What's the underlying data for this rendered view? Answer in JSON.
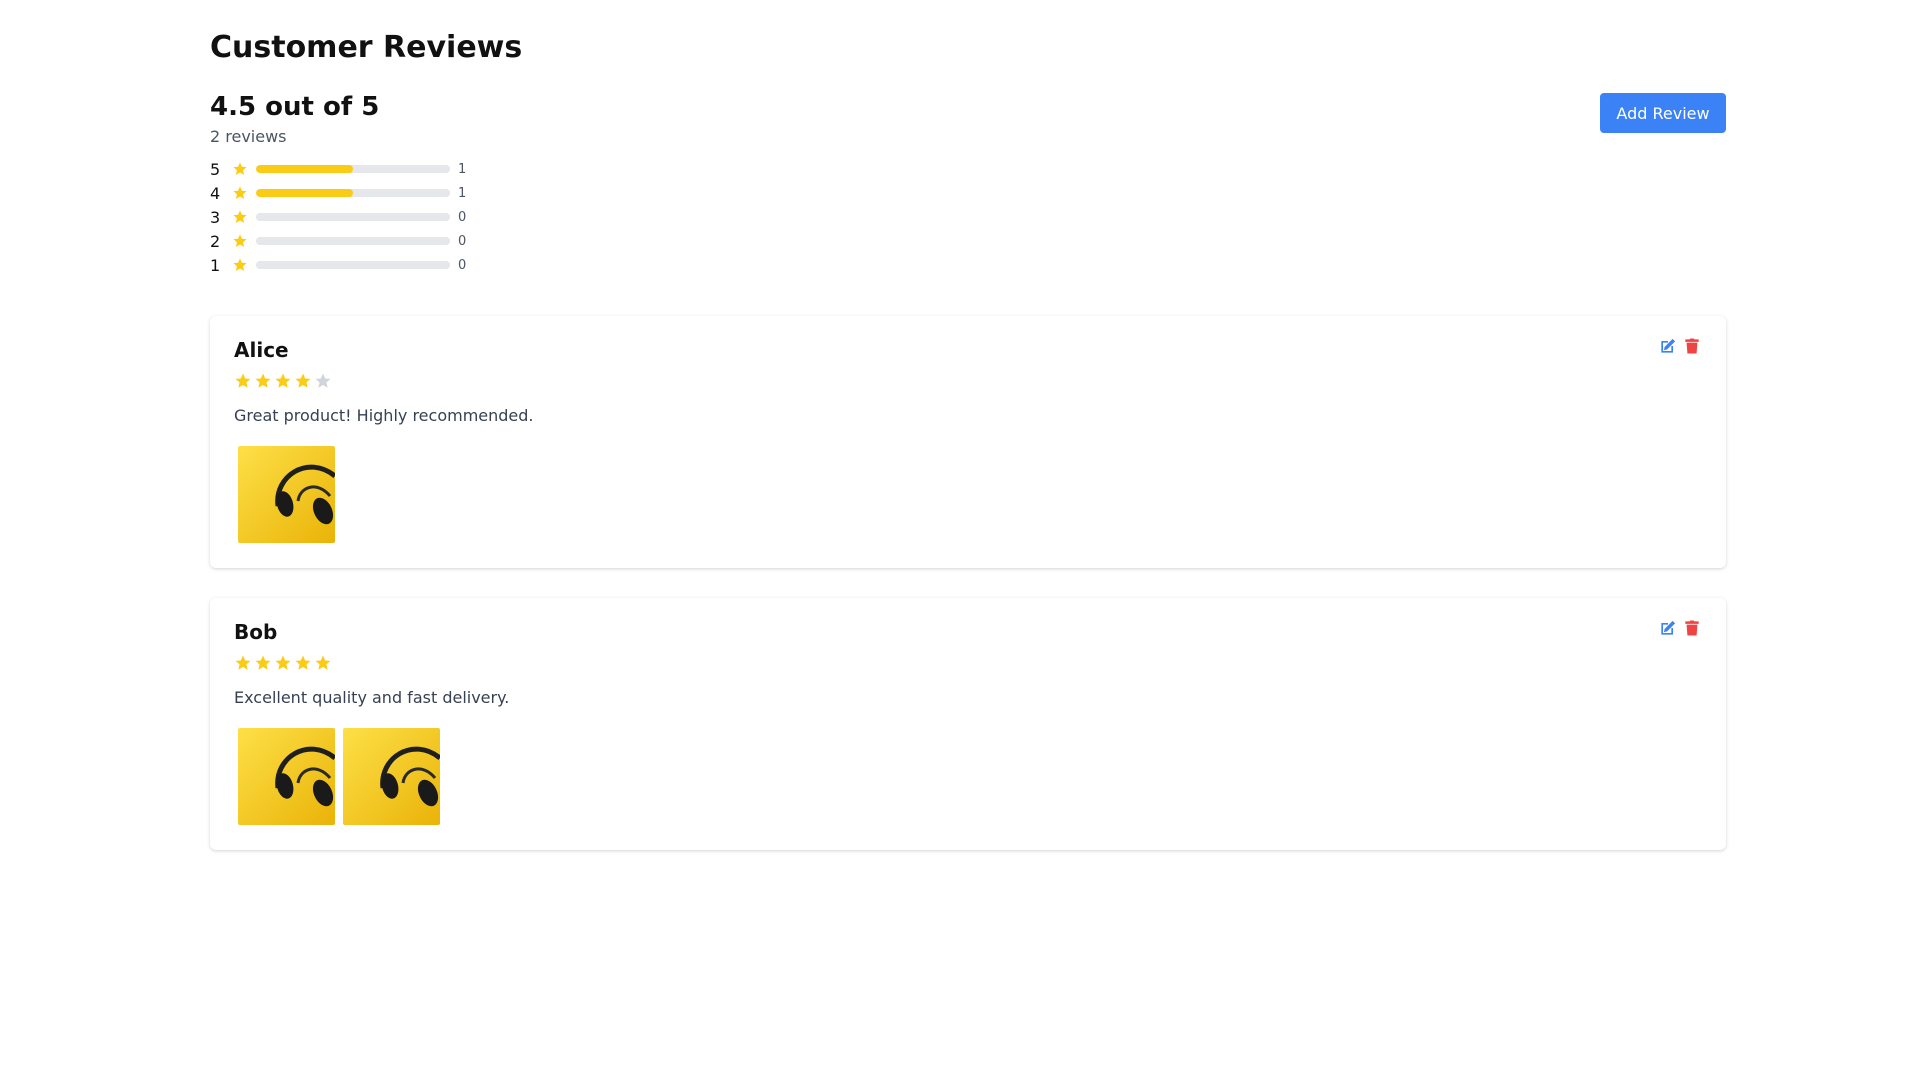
{
  "page": {
    "title": "Customer Reviews"
  },
  "summary": {
    "average_label": "4.5 out of 5",
    "count_label": "2 reviews",
    "add_button_label": "Add Review",
    "breakdown": [
      {
        "stars": "5",
        "count": "1",
        "fraction": 0.5
      },
      {
        "stars": "4",
        "count": "1",
        "fraction": 0.5
      },
      {
        "stars": "3",
        "count": "0",
        "fraction": 0
      },
      {
        "stars": "2",
        "count": "0",
        "fraction": 0
      },
      {
        "stars": "1",
        "count": "0",
        "fraction": 0
      }
    ]
  },
  "reviews": [
    {
      "name": "Alice",
      "rating": 4,
      "text": "Great product! Highly recommended.",
      "images": [
        "headphones-photo"
      ]
    },
    {
      "name": "Bob",
      "rating": 5,
      "text": "Excellent quality and fast delivery.",
      "images": [
        "headphones-photo",
        "headphones-photo"
      ]
    }
  ],
  "icons": {
    "star": "star-icon",
    "edit": "edit-icon",
    "delete": "trash-icon"
  },
  "colors": {
    "star_filled": "#facc15",
    "star_empty": "#d1d5db",
    "accent": "#3b82f6",
    "edit": "#3b82f6",
    "delete": "#ef4444"
  }
}
